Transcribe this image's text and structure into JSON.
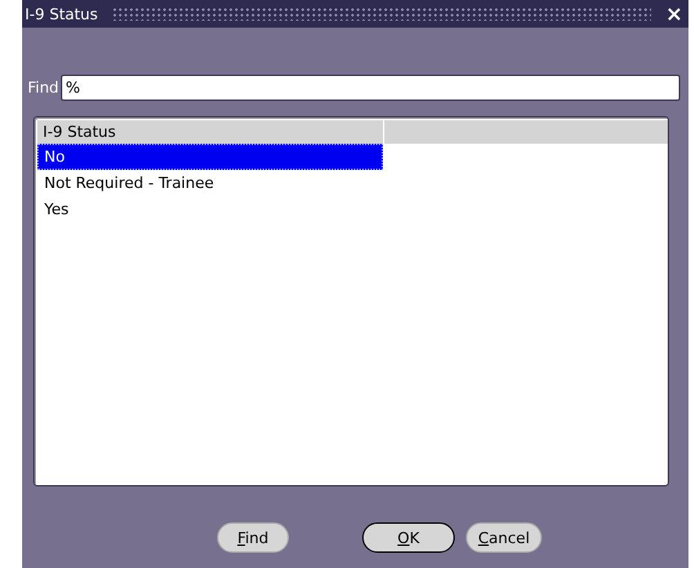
{
  "window": {
    "title": "I-9 Status",
    "close": "×"
  },
  "find": {
    "label": "Find",
    "value": "%"
  },
  "list": {
    "columns": [
      "I-9 Status"
    ],
    "rows": [
      {
        "label": "No",
        "selected": true
      },
      {
        "label": "Not Required - Trainee",
        "selected": false
      },
      {
        "label": "Yes",
        "selected": false
      }
    ]
  },
  "buttons": [
    {
      "label": "Find",
      "default": false
    },
    {
      "label": "OK",
      "default": true
    },
    {
      "label": "Cancel",
      "default": false
    }
  ]
}
